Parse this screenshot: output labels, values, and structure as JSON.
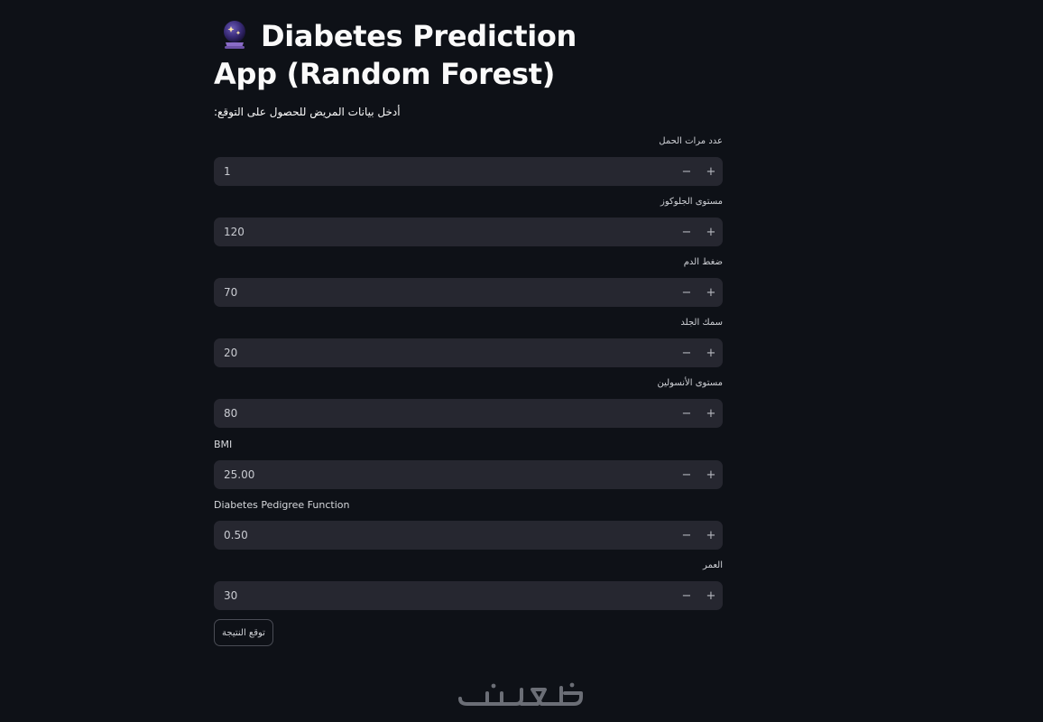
{
  "app": {
    "title": "Diabetes Prediction App (Random Forest)",
    "title_icon": "crystal-ball-icon",
    "subtitle": "أدخل بيانات المريض للحصول على التوقع:"
  },
  "fields": [
    {
      "label": "عدد مرات الحمل",
      "value": "1"
    },
    {
      "label": "مستوى الجلوكوز",
      "value": "120"
    },
    {
      "label": "ضغط الدم",
      "value": "70"
    },
    {
      "label": "سمك الجلد",
      "value": "20"
    },
    {
      "label": "مستوى الأنسولين",
      "value": "80"
    },
    {
      "label": "BMI",
      "value": "25.00"
    },
    {
      "label": "Diabetes Pedigree Function",
      "value": "0.50"
    },
    {
      "label": "العمر",
      "value": "30"
    }
  ],
  "stepper": {
    "minus": "−",
    "plus": "+"
  },
  "predict_button": "توقع النتيجة",
  "watermark": "خمسات",
  "colors": {
    "background": "#0e1117",
    "input_bg": "#262730",
    "text": "#fafafa"
  }
}
